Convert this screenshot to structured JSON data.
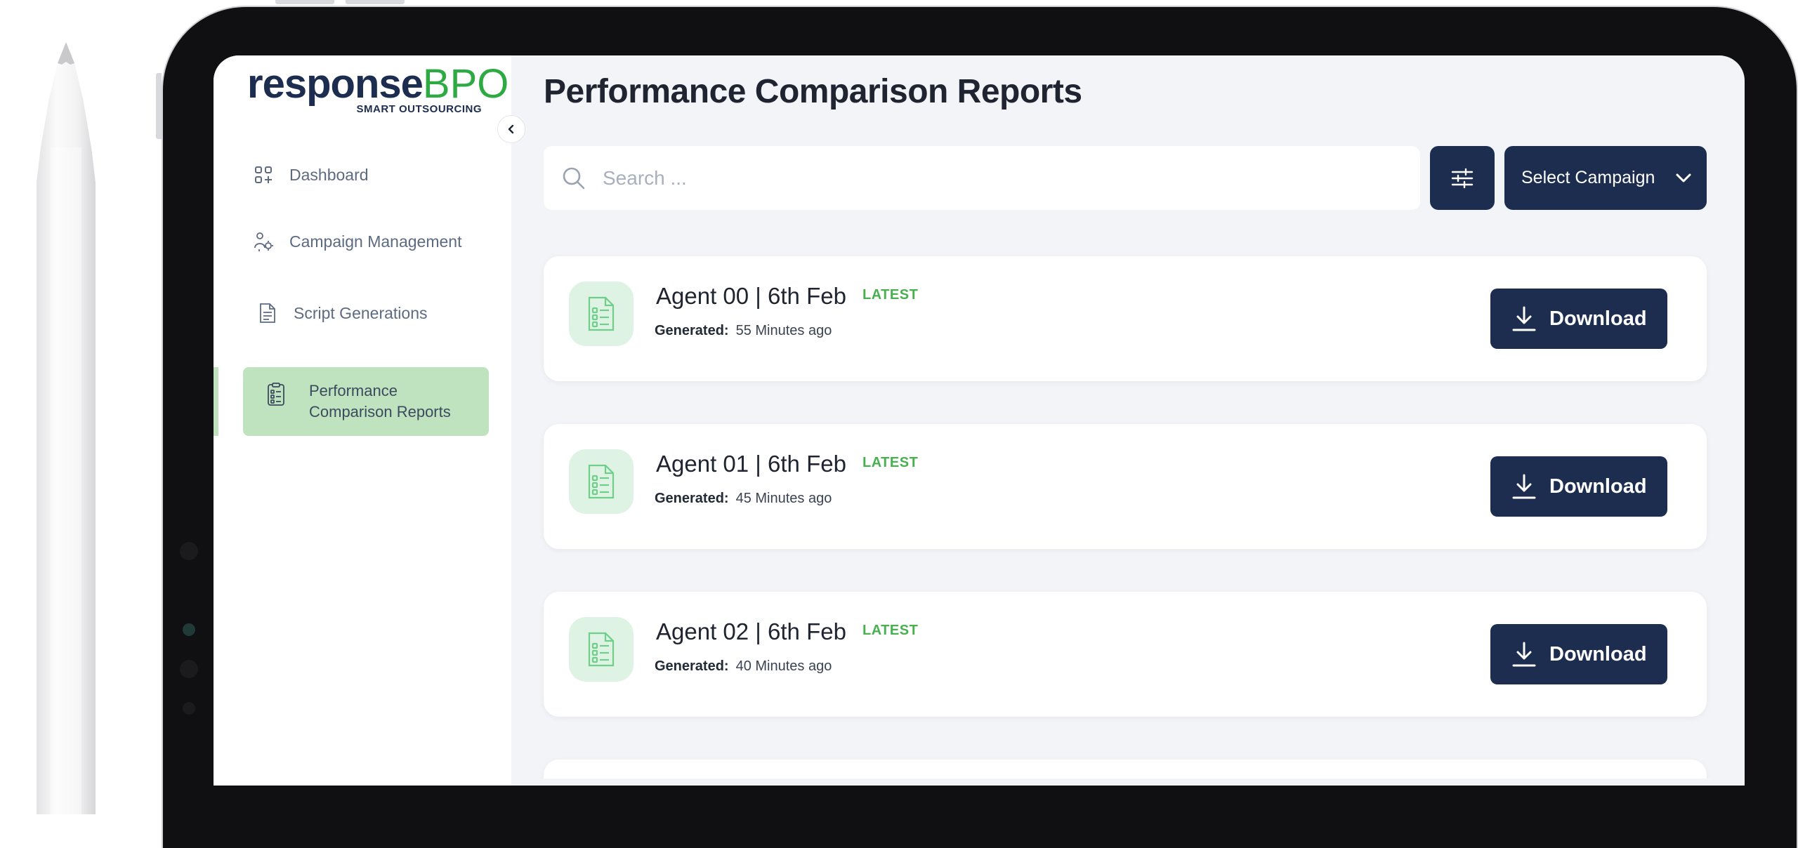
{
  "brand": {
    "logo_main": "response",
    "logo_accent": "BPO",
    "logo_tagline": "SMART OUTSOURCING"
  },
  "sidebar": {
    "items": [
      {
        "label": "Dashboard",
        "icon": "grid-plus-icon"
      },
      {
        "label": "Campaign Management",
        "icon": "people-gear-icon"
      },
      {
        "label": "Script Generations",
        "icon": "document-icon"
      },
      {
        "label": "Performance Comparison Reports",
        "icon": "report-list-icon",
        "active": true
      }
    ]
  },
  "main": {
    "title": "Performance Comparison Reports",
    "search": {
      "placeholder": "Search ...",
      "value": ""
    },
    "campaign_select": {
      "label": "Select Campaign"
    },
    "reports": [
      {
        "title": "Agent 00 | 6th Feb",
        "tag": "LATEST",
        "generated_label": "Generated:",
        "generated_value": "55 Minutes ago",
        "action": "Download"
      },
      {
        "title": "Agent 01 | 6th Feb",
        "tag": "LATEST",
        "generated_label": "Generated:",
        "generated_value": "45 Minutes ago",
        "action": "Download"
      },
      {
        "title": "Agent 02 | 6th Feb",
        "tag": "LATEST",
        "generated_label": "Generated:",
        "generated_value": "40 Minutes ago",
        "action": "Download"
      }
    ]
  },
  "colors": {
    "navy": "#1c2d4f",
    "green_accent": "#2eaa43",
    "active_nav_bg": "#bfe3bf",
    "doc_badge_bg": "#dff3e4",
    "page_bg": "#f3f4f8"
  }
}
